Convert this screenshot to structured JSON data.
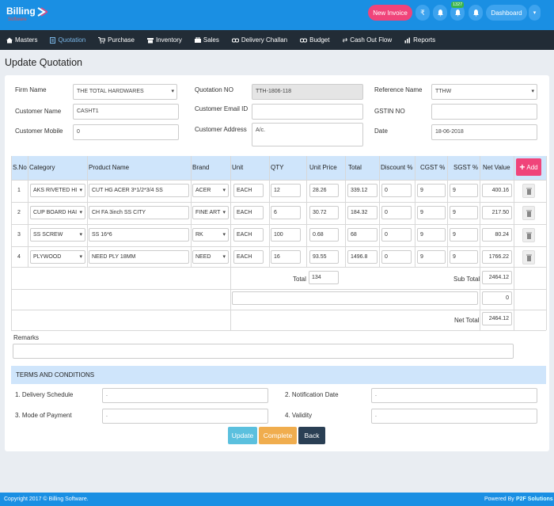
{
  "app": {
    "logo_main": "Billing",
    "logo_sub": "Software"
  },
  "header": {
    "new_invoice": "New Invoice",
    "notif_count": "1327",
    "dashboard": "Dashboard"
  },
  "nav": [
    "Masters",
    "Quotation",
    "Purchase",
    "Inventory",
    "Sales",
    "Delivery Challan",
    "Budget",
    "Cash Out Flow",
    "Reports"
  ],
  "page_title": "Update Quotation",
  "form": {
    "firm_label": "Firm Name",
    "firm_value": "THE TOTAL HARDWARES",
    "qno_label": "Quotation NO",
    "qno_value": "TTH-1806-118",
    "ref_label": "Reference Name",
    "ref_value": "TTHW",
    "cust_label": "Customer Name",
    "cust_value": "CASHT1",
    "email_label": "Customer Email ID",
    "email_value": "",
    "gstin_label": "GSTIN NO",
    "gstin_value": "",
    "mobile_label": "Customer Mobile",
    "mobile_value": "0",
    "addr_label": "Customer Address",
    "addr_value": "A/c.",
    "date_label": "Date",
    "date_value": "18-06-2018"
  },
  "table": {
    "headers": [
      "S.No",
      "Category",
      "Product Name",
      "Brand",
      "Unit",
      "QTY",
      "Unit Price",
      "Total",
      "Discount %",
      "CGST %",
      "SGST %",
      "Net Value"
    ],
    "add_label": "Add",
    "rows": [
      {
        "sno": "1",
        "category": "AKS RIVETED HI",
        "product": "CUT HG ACER 3*1/2*3/4 SS",
        "brand": "ACER",
        "unit": "EACH",
        "qty": "12",
        "price": "28.26",
        "total": "339.12",
        "disc": "0",
        "cgst": "9",
        "sgst": "9",
        "net": "400.16"
      },
      {
        "sno": "2",
        "category": "CUP BOARD HAI",
        "product": "CH FA 3inch SS CITY",
        "brand": "FINE ART",
        "unit": "EACH",
        "qty": "6",
        "price": "30.72",
        "total": "184.32",
        "disc": "0",
        "cgst": "9",
        "sgst": "9",
        "net": "217.50"
      },
      {
        "sno": "3",
        "category": "SS SCREW",
        "product": "SS 16*6",
        "brand": "RK",
        "unit": "EACH",
        "qty": "100",
        "price": "0.68",
        "total": "68",
        "disc": "0",
        "cgst": "9",
        "sgst": "9",
        "net": "80.24"
      },
      {
        "sno": "4",
        "category": "PLYWOOD",
        "product": "NEED PLY 18MM",
        "brand": "NEED",
        "unit": "EACH",
        "qty": "16",
        "price": "93.55",
        "total": "1496.8",
        "disc": "0",
        "cgst": "9",
        "sgst": "9",
        "net": "1766.22"
      }
    ],
    "total_label": "Total",
    "total_qty": "134",
    "subtotal_label": "Sub Total",
    "subtotal_value": "2464.12",
    "adjust_desc": "",
    "adjust_value": "0",
    "nettotal_label": "Net Total",
    "nettotal_value": "2464.12"
  },
  "remarks_label": "Remarks",
  "remarks_value": "",
  "terms": {
    "heading": "TERMS AND CONDITIONS",
    "delivery_label": "1. Delivery Schedule",
    "delivery_value": ".",
    "notification_label": "2. Notification Date",
    "notification_value": ".",
    "payment_label": "3. Mode of Payment",
    "payment_value": ".",
    "validity_label": "4. Validity",
    "validity_value": "."
  },
  "buttons": {
    "update": "Update",
    "complete": "Complete",
    "back": "Back"
  },
  "footer": {
    "copyright": "Copyright 2017 © Billing Software.",
    "powered": "Powered By",
    "powered_brand": "P2F Solutions"
  },
  "colors": {
    "primary": "#1a8fe3",
    "nav_bg": "#222c36",
    "pink": "#f0447a",
    "table_head": "#cfe5fb",
    "update": "#5bc0de",
    "complete": "#f0ad4e",
    "back": "#2a3f54"
  }
}
